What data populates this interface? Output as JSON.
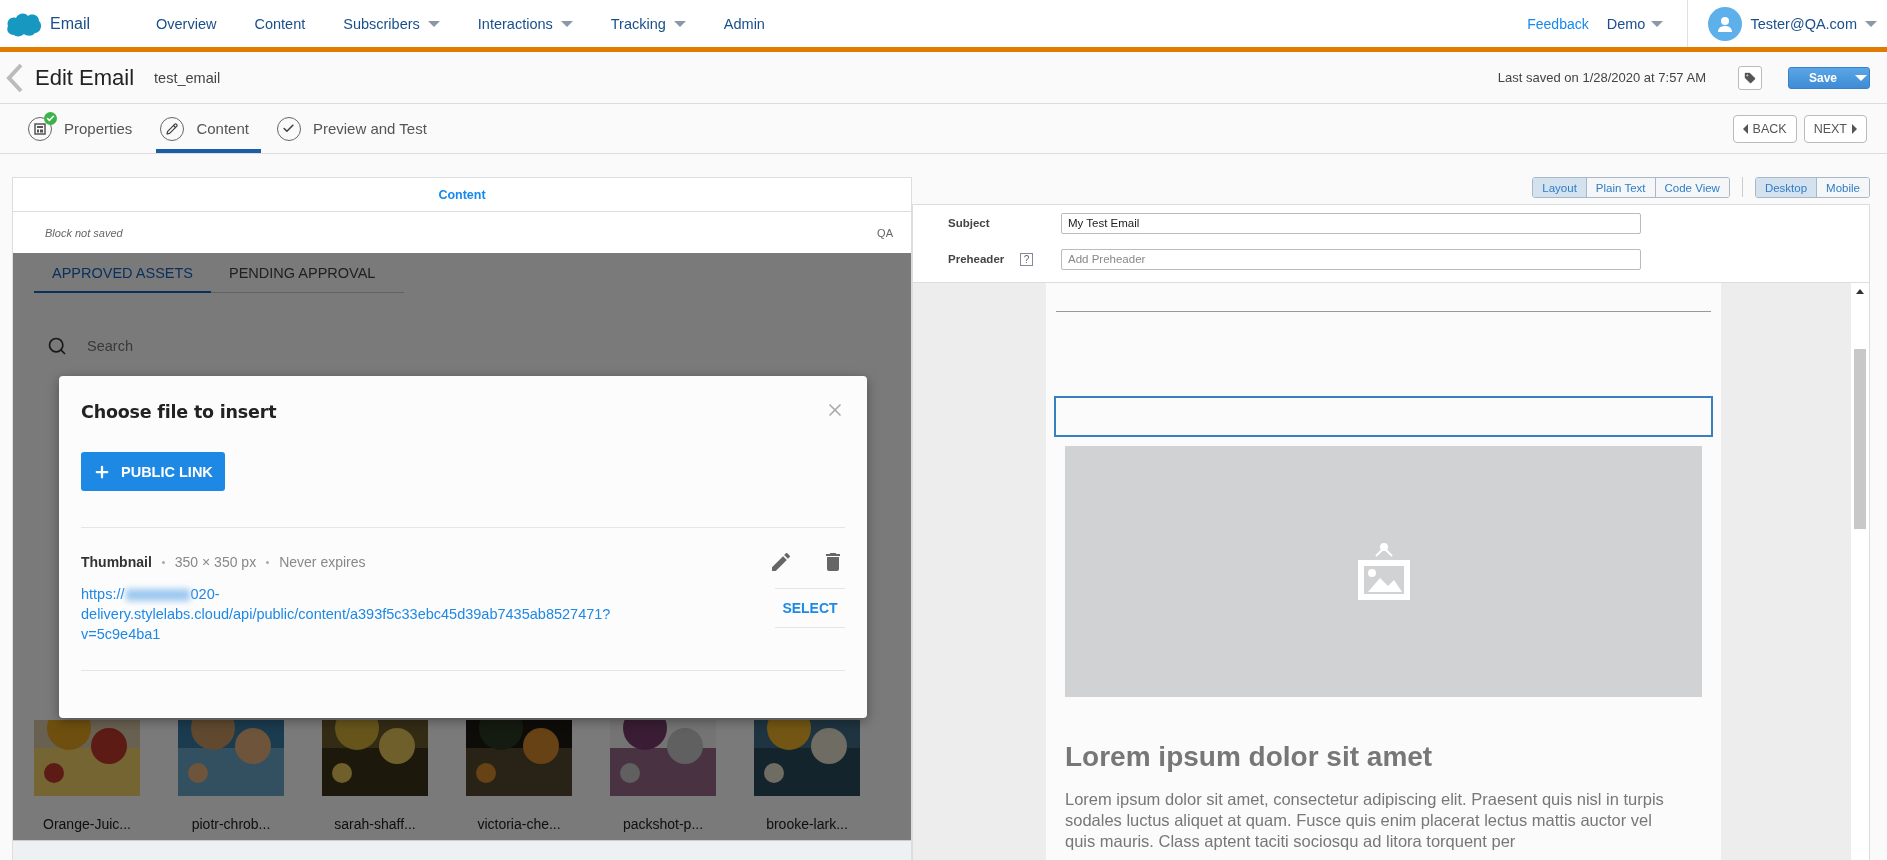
{
  "nav": {
    "brand": "Email",
    "items": [
      {
        "label": "Overview",
        "dropdown": false
      },
      {
        "label": "Content",
        "dropdown": false
      },
      {
        "label": "Subscribers",
        "dropdown": true
      },
      {
        "label": "Interactions",
        "dropdown": true
      },
      {
        "label": "Tracking",
        "dropdown": true
      },
      {
        "label": "Admin",
        "dropdown": false
      }
    ],
    "feedback": "Feedback",
    "org": "Demo",
    "user": "Tester@QA.com"
  },
  "header": {
    "title": "Edit Email",
    "name": "test_email",
    "last_saved": "Last saved on 1/28/2020 at 7:57 AM",
    "save": "Save"
  },
  "steps": [
    {
      "label": "Properties",
      "kind": "properties",
      "selected": false,
      "completed": true
    },
    {
      "label": "Content",
      "kind": "edit",
      "selected": true,
      "completed": false
    },
    {
      "label": "Preview and Test",
      "kind": "check",
      "selected": false,
      "completed": false
    }
  ],
  "pager": {
    "back": "BACK",
    "next": "NEXT"
  },
  "content_panel": {
    "title": "Content",
    "status": "Block not saved",
    "badge": "QA",
    "asset_tabs": [
      {
        "label": "APPROVED ASSETS",
        "selected": true
      },
      {
        "label": "PENDING APPROVAL",
        "selected": false
      }
    ],
    "search_placeholder": "Search",
    "assets": [
      {
        "name": "Orange-Juic..."
      },
      {
        "name": "piotr-chrob..."
      },
      {
        "name": "sarah-shaff..."
      },
      {
        "name": "victoria-che..."
      },
      {
        "name": "packshot-p..."
      },
      {
        "name": "brooke-lark..."
      }
    ]
  },
  "dialog": {
    "title": "Choose file to insert",
    "add_button": "PUBLIC LINK",
    "file": {
      "name": "Thumbnail",
      "size": "350 × 350 px",
      "expiry": "Never expires",
      "url_head": "https://",
      "url_tail": "020-delivery.stylelabs.cloud/api/public/content/a393f5c33ebc45d39ab7435ab8527471?v=5c9e4ba1",
      "action": "SELECT"
    }
  },
  "view_modes": [
    {
      "label": "Layout",
      "selected": true
    },
    {
      "label": "Plain Text",
      "selected": false
    },
    {
      "label": "Code View",
      "selected": false
    }
  ],
  "devices": [
    {
      "label": "Desktop",
      "selected": true
    },
    {
      "label": "Mobile",
      "selected": false
    }
  ],
  "fields": [
    {
      "label": "Subject",
      "value": "My Test Email",
      "help": false
    },
    {
      "label": "Preheader",
      "placeholder": "Add Preheader",
      "help": true,
      "help_icon": "?"
    }
  ],
  "email": {
    "heading": "Lorem ipsum dolor sit amet",
    "body": "Lorem ipsum dolor sit amet, consectetur adipiscing elit. Praesent quis nisl in turpis sodales luctus aliquet at quam. Fusce quis enim placerat lectus mattis auctor vel quis mauris. Class aptent taciti sociosqu ad litora torquent per"
  }
}
